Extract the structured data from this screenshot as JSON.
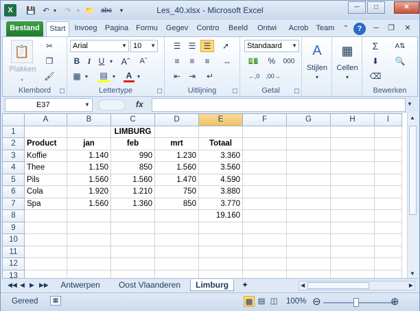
{
  "title": "Les_40.xlsx - Microsoft Excel",
  "tabs": [
    "Bestand",
    "Start",
    "Invoeg",
    "Pagina",
    "Formu",
    "Gegev",
    "Contro",
    "Beeld",
    "Ontwi",
    "Acrob",
    "Team"
  ],
  "ribbon": {
    "clipboard": {
      "paste": "Plakken",
      "label": "Klembord"
    },
    "font": {
      "name": "Arial",
      "size": "10",
      "label": "Lettertype"
    },
    "alignment": {
      "label": "Uitlijning"
    },
    "number": {
      "format": "Standaard",
      "label": "Getal"
    },
    "styles": {
      "label": "Stijlen"
    },
    "cells": {
      "label": "Cellen"
    },
    "editing": {
      "label": "Bewerken"
    }
  },
  "formula_bar": {
    "name_box": "E37",
    "fx": "fx",
    "formula": ""
  },
  "columns": [
    "A",
    "B",
    "C",
    "D",
    "E",
    "F",
    "G",
    "H",
    "I"
  ],
  "selected_column": "E",
  "rows": [
    [
      "",
      "",
      "LIMBURG",
      "",
      "",
      "",
      "",
      "",
      ""
    ],
    [
      "Product",
      "jan",
      "feb",
      "mrt",
      "Totaal",
      "",
      "",
      "",
      ""
    ],
    [
      "Koffie",
      "1.140",
      "990",
      "1.230",
      "3.360",
      "",
      "",
      "",
      ""
    ],
    [
      "Thee",
      "1.150",
      "850",
      "1.560",
      "3.560",
      "",
      "",
      "",
      ""
    ],
    [
      "Pils",
      "1.560",
      "1.560",
      "1.470",
      "4.590",
      "",
      "",
      "",
      ""
    ],
    [
      "Cola",
      "1.920",
      "1.210",
      "750",
      "3.880",
      "",
      "",
      "",
      ""
    ],
    [
      "Spa",
      "1.560",
      "1.360",
      "850",
      "3.770",
      "",
      "",
      "",
      ""
    ],
    [
      "",
      "",
      "",
      "",
      "19.160",
      "",
      "",
      "",
      ""
    ],
    [
      "",
      "",
      "",
      "",
      "",
      "",
      "",
      "",
      ""
    ],
    [
      "",
      "",
      "",
      "",
      "",
      "",
      "",
      "",
      ""
    ],
    [
      "",
      "",
      "",
      "",
      "",
      "",
      "",
      "",
      ""
    ],
    [
      "",
      "",
      "",
      "",
      "",
      "",
      "",
      "",
      ""
    ],
    [
      "",
      "",
      "",
      "",
      "",
      "",
      "",
      "",
      ""
    ]
  ],
  "sheet_tabs": [
    "Antwerpen",
    "Oost Vlaanderen",
    "Limburg"
  ],
  "active_sheet": "Limburg",
  "status": {
    "mode": "Gereed",
    "zoom": "100%"
  }
}
